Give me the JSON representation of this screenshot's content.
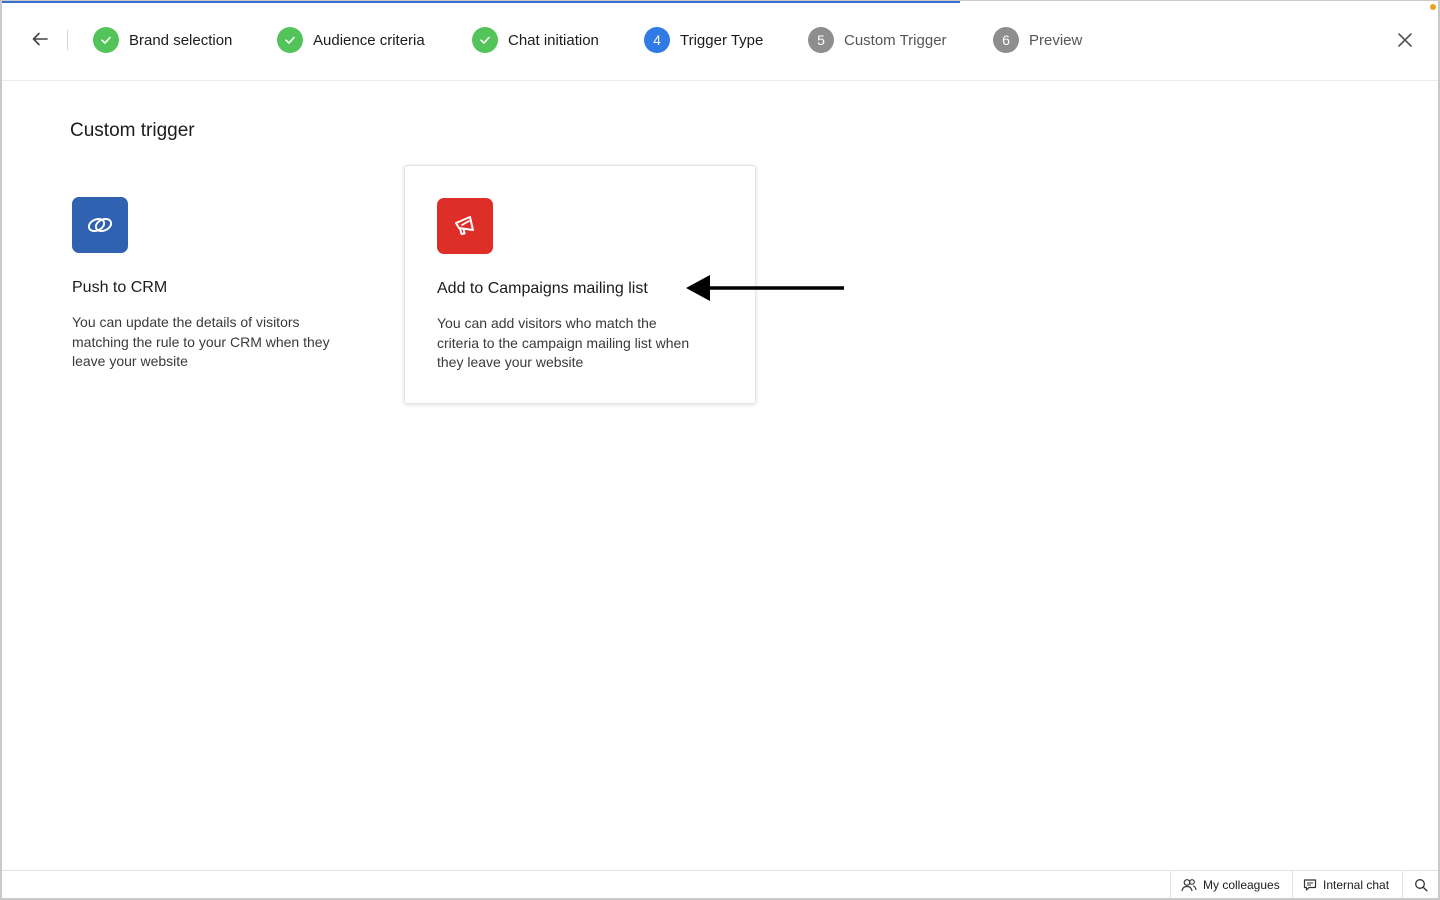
{
  "header": {
    "steps": [
      {
        "number": "",
        "label": "Brand selection",
        "state": "done"
      },
      {
        "number": "",
        "label": "Audience criteria",
        "state": "done"
      },
      {
        "number": "",
        "label": "Chat initiation",
        "state": "done"
      },
      {
        "number": "4",
        "label": "Trigger Type",
        "state": "active"
      },
      {
        "number": "5",
        "label": "Custom Trigger",
        "state": "pending"
      },
      {
        "number": "6",
        "label": "Preview",
        "state": "pending"
      }
    ],
    "icons": {
      "back": "arrow-left-icon",
      "close": "close-icon"
    }
  },
  "main": {
    "title": "Custom trigger",
    "options": [
      {
        "title": "Push to CRM",
        "description": "You can update the details of visitors matching the rule to your CRM when they leave your website",
        "icon": "crm-icon",
        "icon_color": "#2f62b0",
        "selected": false
      },
      {
        "title": "Add to Campaigns mailing list",
        "description": "You can add visitors who match the criteria to the campaign mailing list when they leave your website",
        "icon": "megaphone-icon",
        "icon_color": "#dd2e28",
        "selected": true
      }
    ]
  },
  "footer": {
    "colleagues_label": "My colleagues",
    "internal_chat_label": "Internal chat"
  },
  "colors": {
    "accent": "#2f7ae5",
    "done": "#52c45a",
    "pending": "#8e8e8e"
  }
}
